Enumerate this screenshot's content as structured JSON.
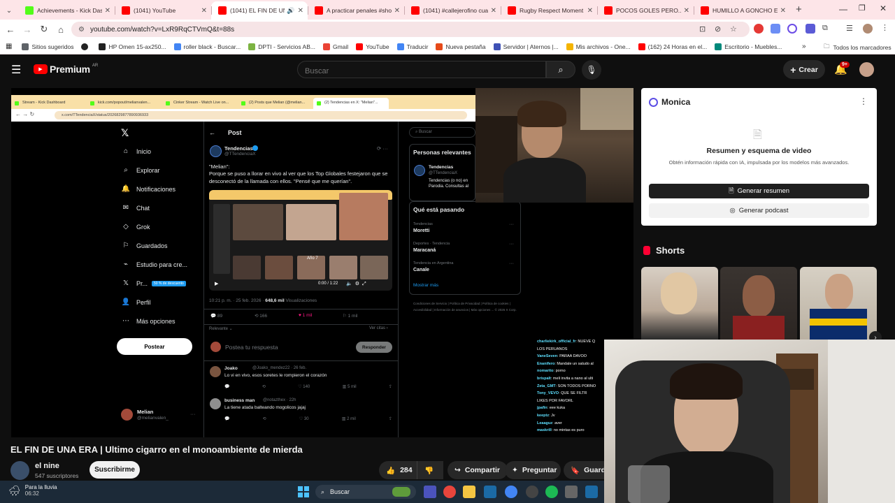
{
  "browser": {
    "tabs": [
      {
        "title": "Achievements - Kick Dash",
        "color": "#53fc18",
        "active": false
      },
      {
        "title": "(1041) YouTube",
        "color": "#ff0000",
        "active": false
      },
      {
        "title": "(1041) EL FIN DE UNA",
        "color": "#ff0000",
        "active": true
      },
      {
        "title": "A practicar penales #shor",
        "color": "#ff0000",
        "active": false
      },
      {
        "title": "(1041) #callejerofino cuar",
        "color": "#ff0000",
        "active": false
      },
      {
        "title": "Rugby Respect Moment",
        "color": "#ff0000",
        "active": false
      },
      {
        "title": "POCOS GOLES PERO... - Y",
        "color": "#ff0000",
        "active": false
      },
      {
        "title": "HUMILLO A GONCHO EN",
        "color": "#ff0000",
        "active": false
      }
    ],
    "new_tab": "+",
    "url": "youtube.com/watch?v=LxR9RqCTVmQ&t=88s",
    "bookmarks": [
      {
        "label": "Sitios sugeridos",
        "color": "#5f6368"
      },
      {
        "label": "",
        "color": "#222"
      },
      {
        "label": "HP Omen 15-ax250...",
        "color": "#222"
      },
      {
        "label": "roller black - Buscar...",
        "color": "#4285f4"
      },
      {
        "label": "DPTI - Servicios AB...",
        "color": "#7cb342"
      },
      {
        "label": "Gmail",
        "color": "#ea4335"
      },
      {
        "label": "YouTube",
        "color": "#ff0000"
      },
      {
        "label": "Traducir",
        "color": "#4285f4"
      },
      {
        "label": "Nueva pestaña",
        "color": "#e64a19"
      },
      {
        "label": "Servidor | Aternos |...",
        "color": "#3f51b5"
      },
      {
        "label": "Mis archivos - One...",
        "color": "#f4b400"
      },
      {
        "label": "(162) 24 Horas en el...",
        "color": "#ff0000"
      },
      {
        "label": "Escritorio - Muebles...",
        "color": "#00897b"
      }
    ],
    "bookmarks_more": "»",
    "all_bookmarks": "Todos los marcadores"
  },
  "youtube": {
    "logo": "Premium",
    "region": "AR",
    "search_placeholder": "Buscar",
    "create_label": "Crear",
    "notif_badge": "9+",
    "video_title": "EL FIN DE UNA ERA | Ultimo cigarro en el monoambiente de mierda",
    "channel_name": "el nine",
    "subscribers": "547 suscriptores",
    "subscribe_label": "Suscribirme",
    "likes": "284",
    "share_label": "Compartir",
    "ask_label": "Preguntar",
    "save_label": "Guardar"
  },
  "monica": {
    "name": "Monica",
    "heading": "Resumen y esquema de video",
    "description": "Obtén información rápida con IA, impulsada por los modelos más avanzados.",
    "summary_btn": "Generar resumen",
    "podcast_btn": "Generar podcast"
  },
  "shorts": {
    "label": "Shorts"
  },
  "video_content": {
    "inner_tabs": [
      "Stream - Kick Dashboard",
      "kick.com/popout/melianvalen...",
      "Cinker Stream - Watch Live on...",
      "(2) Posts que Melian (@melian...",
      "(2) Tendencias en X: \"Melian\"..."
    ],
    "inner_url": "x.com/TTendenciaX/status/2026829877890936933",
    "x_nav": [
      "Inicio",
      "Explorar",
      "Notificaciones",
      "Chat",
      "Grok",
      "Guardados",
      "Estudio para cre...",
      "Pr...",
      "Perfil",
      "Más opciones"
    ],
    "premium_badge": "50 % de descuento",
    "post_button": "Postear",
    "post_header": "Post",
    "account_name": "Tendencias",
    "account_handle": "@TTendenciaX",
    "post_quote": "\"Melian\":",
    "post_text": "Porque se puso a llorar en vivo al ver que los Top Globales festejaron que se desconectó de la llamada con ellos. \"Pensé que me querían\".",
    "media_time": "0:00 / 1:22",
    "media_caption": "Año 7",
    "post_meta": "10:21 p. m. · 25 feb. 2026 · ",
    "views": "648,6 mil",
    "views_label": "Visualizaciones",
    "stats": [
      "89",
      "166",
      "1 mil",
      "1 mil"
    ],
    "relevante": "Relevante ⌄",
    "ver_citas": "Ver citas ›",
    "reply_placeholder": "Postea tu respuesta",
    "reply_btn": "Responder",
    "replies": [
      {
        "name": "Joako",
        "meta": "@Joako_mendez22 · 26 feb.",
        "text": "Lo vi en vivo, esos soretes le rompieron el corazón",
        "likes": "140",
        "views": "5 mil"
      },
      {
        "name": "business man",
        "meta": "@notazthex · 22h",
        "text": "La tiene atada balteando mogolicos jajaj",
        "likes": "30",
        "views": "2 mil"
      }
    ],
    "profile_name": "Melian",
    "profile_handle": "@melianvalen_",
    "search_x": "Buscar",
    "relevant_people": "Personas relevantes",
    "relevant_desc": "Tendencias (o no) en Parodia. Consultas al",
    "trending_header": "Qué está pasando",
    "trends": [
      {
        "cat": "Tendencias",
        "name": "Moretti"
      },
      {
        "cat": "Deportes · Tendencia",
        "name": "Maracaná"
      },
      {
        "cat": "Tendencia en Argentina",
        "name": "Canale"
      }
    ],
    "show_more": "Mostrar más",
    "footer_links": "Condiciones de Servicio  |  Política de Privacidad  |  Política de cookies  |  Accesibilidad  |  Información de anuncios  |  Más opciones ...  © 2026 X Corp.",
    "chat": [
      {
        "user": "charliekirk_official_fr",
        "msg": ": NUEVE Q"
      },
      {
        "user": "",
        "msg": "LOS PERUANOS"
      },
      {
        "user": "VaneSeven",
        "msg": ": PARAA DAVOO"
      },
      {
        "user": "Enanifero",
        "msg": ": Mandale un saludo al"
      },
      {
        "user": "nomarito",
        "msg": ": porno"
      },
      {
        "user": "brispalt",
        "msg": ": meli invita a nano al ulti"
      },
      {
        "user": "Zeta_GMT",
        "msg": ": SON TODOS PORNO"
      },
      {
        "user": "Tony_VEVO",
        "msg": ": QUE SE FILTR"
      },
      {
        "user": "",
        "msg": "LIKES POR FAVORL"
      },
      {
        "user": "jpafin",
        "msg": ": eee kuka"
      },
      {
        "user": "keeptz",
        "msg": ": Jv"
      },
      {
        "user": "Leaaguz",
        "msg": ": aver"
      },
      {
        "user": "maskrill",
        "msg": ": no mintas es puro"
      }
    ]
  },
  "taskbar": {
    "weather": "Para la lluvia",
    "time": "06:32",
    "search": "Buscar"
  }
}
